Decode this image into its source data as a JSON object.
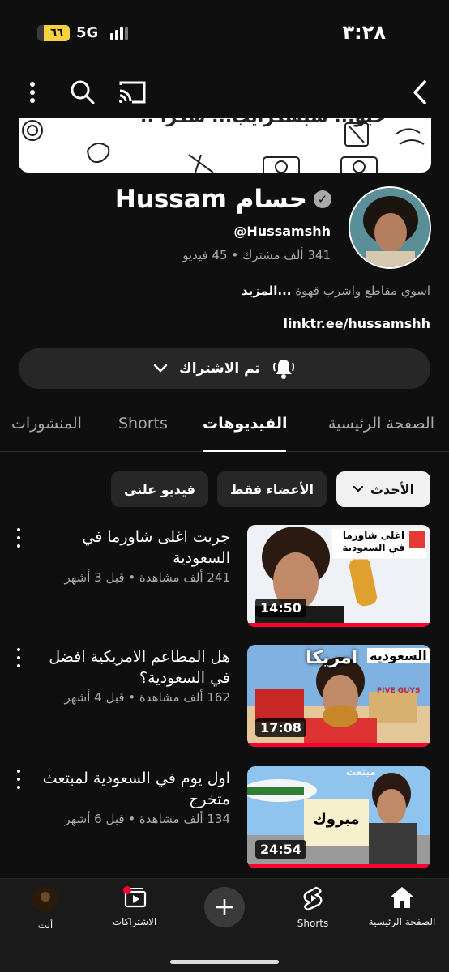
{
  "status_bar": {
    "battery": "٦٦",
    "network": "5G",
    "time": "٣:٢٨"
  },
  "banner": {
    "text": "حيو... سبسكرايب... شكرا :."
  },
  "channel": {
    "name": "حسام Hussam",
    "handle": "@Hussamshh",
    "stats": "341 ألف مشترك • 45 فيديو",
    "description": "اسوي مقاطع واشرب قهوة",
    "more": "...المزيد",
    "link": "linktr.ee/hussamshh",
    "subscribe_label": "تم الاشتراك"
  },
  "tabs": [
    "الصفحة الرئيسية",
    "الفيديوهات",
    "Shorts",
    "المنشورات"
  ],
  "chips": {
    "sort": "الأحدث",
    "members": "الأعضاء فقط",
    "for_you": "فيديو علني"
  },
  "videos": [
    {
      "title": "جربت اغلى شاورما في السعودية",
      "meta": "241 ألف مشاهدة • قبل 3 أشهر",
      "duration": "14:50",
      "overlay": "اغلى شاورما في السعودية"
    },
    {
      "title": "هل المطاعم الامريكية افضل في السعودية؟",
      "meta": "162 ألف مشاهدة • قبل 4 أشهر",
      "duration": "17:08",
      "overlay_left": "امريكا",
      "overlay_right": "السعودية",
      "sign": "FIVE GUYS"
    },
    {
      "title": "اول يوم في السعودية لمبتعث متخرج",
      "meta": "134 ألف مشاهدة • قبل 6 أشهر",
      "duration": "24:54",
      "overlay": "مبروك",
      "tag": "مبتعث"
    }
  ],
  "bottom_nav": {
    "home": "الصفحة الرئيسية",
    "shorts": "Shorts",
    "subscriptions": "الاشتراكات",
    "you": "أنت"
  },
  "colors": {
    "background": "#0f0f0f",
    "accent": "#ff0033",
    "chip": "#272727"
  },
  "icons": [
    "back-arrow-icon",
    "cast-icon",
    "search-icon",
    "more-vert-icon",
    "verified-icon",
    "bell-icon",
    "chevron-down-icon",
    "home-icon",
    "shorts-icon",
    "create-icon",
    "subscriptions-icon"
  ]
}
